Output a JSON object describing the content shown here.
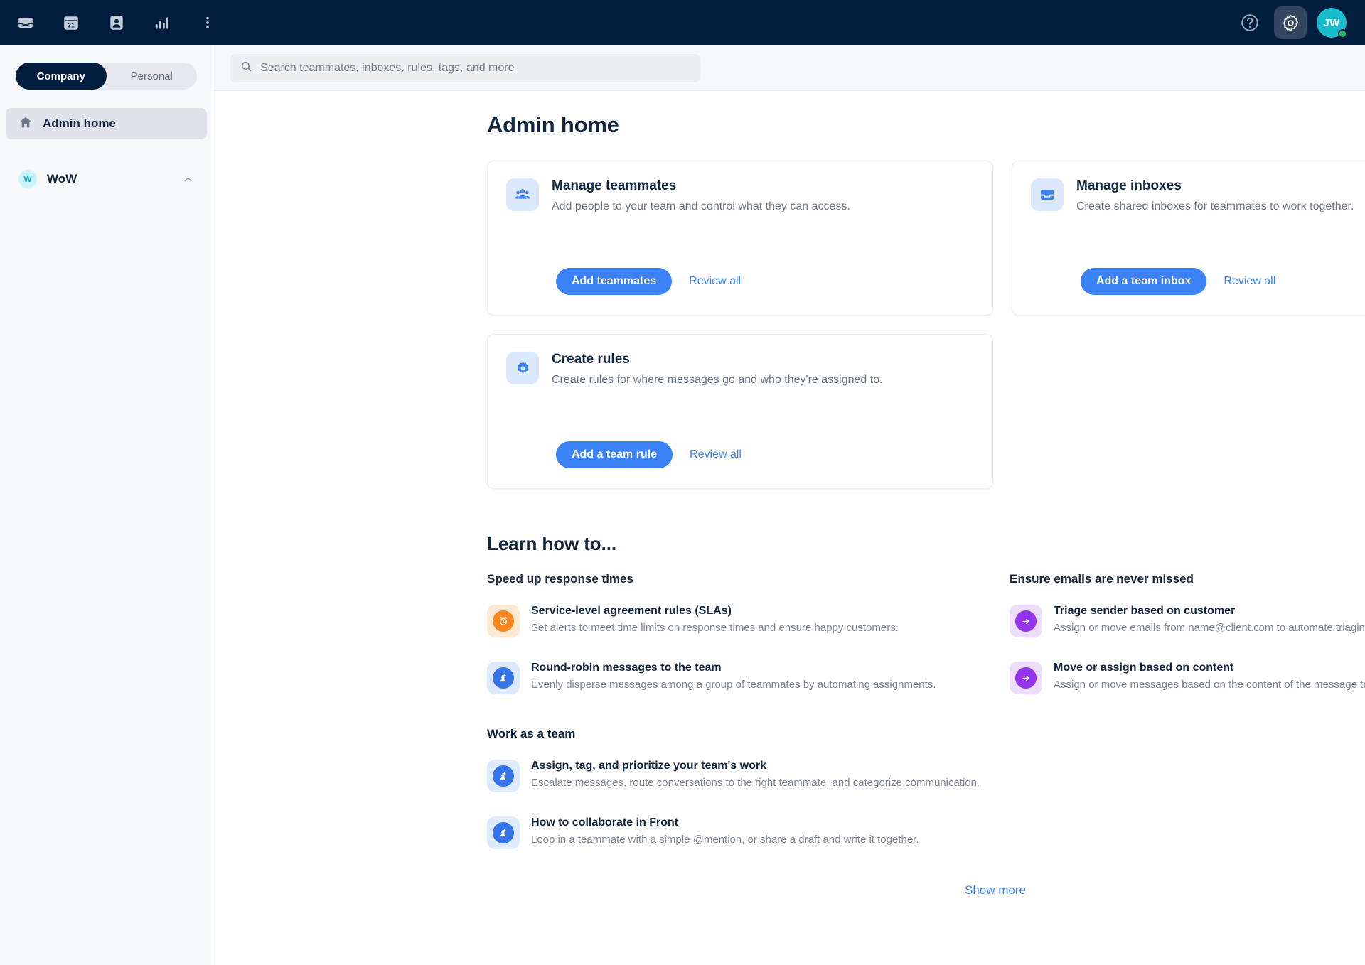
{
  "topbar": {
    "icons": [
      {
        "name": "inbox-icon",
        "label": "Inbox"
      },
      {
        "name": "calendar-icon",
        "label": "Calendar",
        "day": "31"
      },
      {
        "name": "contacts-icon",
        "label": "Contacts"
      },
      {
        "name": "analytics-icon",
        "label": "Analytics"
      },
      {
        "name": "more-options-icon",
        "label": "More"
      }
    ],
    "help_label": "Help",
    "settings_label": "Settings",
    "avatar_initials": "JW",
    "presence_color": "#2bb673",
    "avatar_color": "#19bccc",
    "background_color": "#021e3e"
  },
  "sidebar": {
    "segments": [
      {
        "label": "Company",
        "active": true
      },
      {
        "label": "Personal",
        "active": false
      }
    ],
    "nav": [
      {
        "label": "Admin home",
        "icon": "home-icon",
        "active": true
      }
    ],
    "workspace": {
      "badge": "W",
      "name": "WoW",
      "chevron": "chevron-up-icon"
    }
  },
  "search": {
    "placeholder": "Search teammates, inboxes, rules, tags, and more",
    "value": ""
  },
  "main": {
    "page_title": "Admin home",
    "cards": [
      {
        "icon": "people-icon",
        "title": "Manage teammates",
        "description": "Add people to your team and control what they can access.",
        "primary_label": "Add teammates",
        "link_label": "Review all"
      },
      {
        "icon": "inbox-icon",
        "title": "Manage inboxes",
        "description": "Create shared inboxes for teammates to work together.",
        "primary_label": "Add a team inbox",
        "link_label": "Review all"
      },
      {
        "icon": "gear-icon",
        "title": "Create rules",
        "description": "Create rules for where messages go and who they're assigned to.",
        "primary_label": "Add a team rule",
        "link_label": "Review all"
      }
    ],
    "learn": {
      "title": "Learn how to...",
      "sections": [
        {
          "heading": "Speed up response times",
          "items": [
            {
              "icon": "alarm-clock-icon",
              "icon_style": "orange",
              "title": "Service-level agreement rules (SLAs)",
              "description": "Set alerts to meet time limits on response times and ensure happy customers."
            },
            {
              "icon": "assign-person-icon",
              "icon_style": "blue",
              "title": "Round-robin messages to the team",
              "description": "Evenly disperse messages among a group of teammates by automating assignments."
            }
          ]
        },
        {
          "heading": "Ensure emails are never missed",
          "items": [
            {
              "icon": "arrow-right-icon",
              "icon_style": "purple",
              "title": "Triage sender based on customer",
              "description": "Assign or move emails from name@client.com to automate triaging by customer."
            },
            {
              "icon": "arrow-right-icon",
              "icon_style": "purple",
              "title": "Move or assign based on content",
              "description": "Assign or move messages based on the content of the message to triage by expertise."
            }
          ]
        },
        {
          "heading": "Work as a team",
          "items": [
            {
              "icon": "assign-person-icon",
              "icon_style": "blue",
              "title": "Assign, tag, and prioritize your team's work",
              "description": "Escalate messages, route conversations to the right teammate, and categorize communication."
            },
            {
              "icon": "assign-person-icon",
              "icon_style": "blue",
              "title": "How to collaborate in Front",
              "description": "Loop in a teammate with a simple @mention, or share a draft and write it together."
            }
          ]
        }
      ],
      "show_more_label": "Show more"
    }
  },
  "colors": {
    "accent_blue": "#3b82f6",
    "navy": "#021e3e",
    "orange": "#f7861c",
    "purple": "#9333ea"
  }
}
